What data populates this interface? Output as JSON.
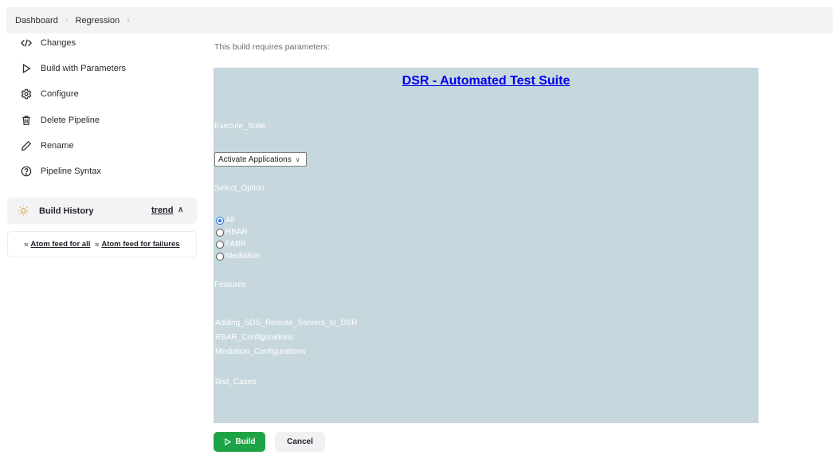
{
  "breadcrumb": {
    "items": [
      "Dashboard",
      "Regression"
    ]
  },
  "sidebar": {
    "items": [
      {
        "label": "Changes",
        "icon": "code-icon"
      },
      {
        "label": "Build with Parameters",
        "icon": "play-icon"
      },
      {
        "label": "Configure",
        "icon": "gear-icon"
      },
      {
        "label": "Delete Pipeline",
        "icon": "trash-icon"
      },
      {
        "label": "Rename",
        "icon": "pencil-icon"
      },
      {
        "label": "Pipeline Syntax",
        "icon": "help-icon"
      }
    ],
    "build_history": {
      "label": "Build History",
      "trend": "trend",
      "icon": "sun-icon"
    },
    "feeds": {
      "all": "Atom feed for all",
      "failures": "Atom feed for failures"
    }
  },
  "main": {
    "requires_text": "This build requires parameters:",
    "suite_title": "DSR - Automated Test Suite",
    "execute_suite": {
      "label": "Execute_Suite",
      "selected": "Activate Applications"
    },
    "select_option": {
      "label": "Select_Option",
      "options": [
        "All",
        "RBAR",
        "FABR",
        "Mediation"
      ],
      "selected": "All"
    },
    "features": {
      "label": "Features",
      "items": [
        "Adding_SDS_Remote_Servers_to_DSR",
        "RBAR_Configurations",
        "Mediation_Configurations"
      ]
    },
    "test_cases": {
      "label": "Test_Cases"
    }
  },
  "buttons": {
    "build": "Build",
    "cancel": "Cancel"
  },
  "colors": {
    "panel": "#c6d7dd",
    "build_button": "#1ea446",
    "link": "#0000ee",
    "radio_selected": "#1a73e8"
  }
}
